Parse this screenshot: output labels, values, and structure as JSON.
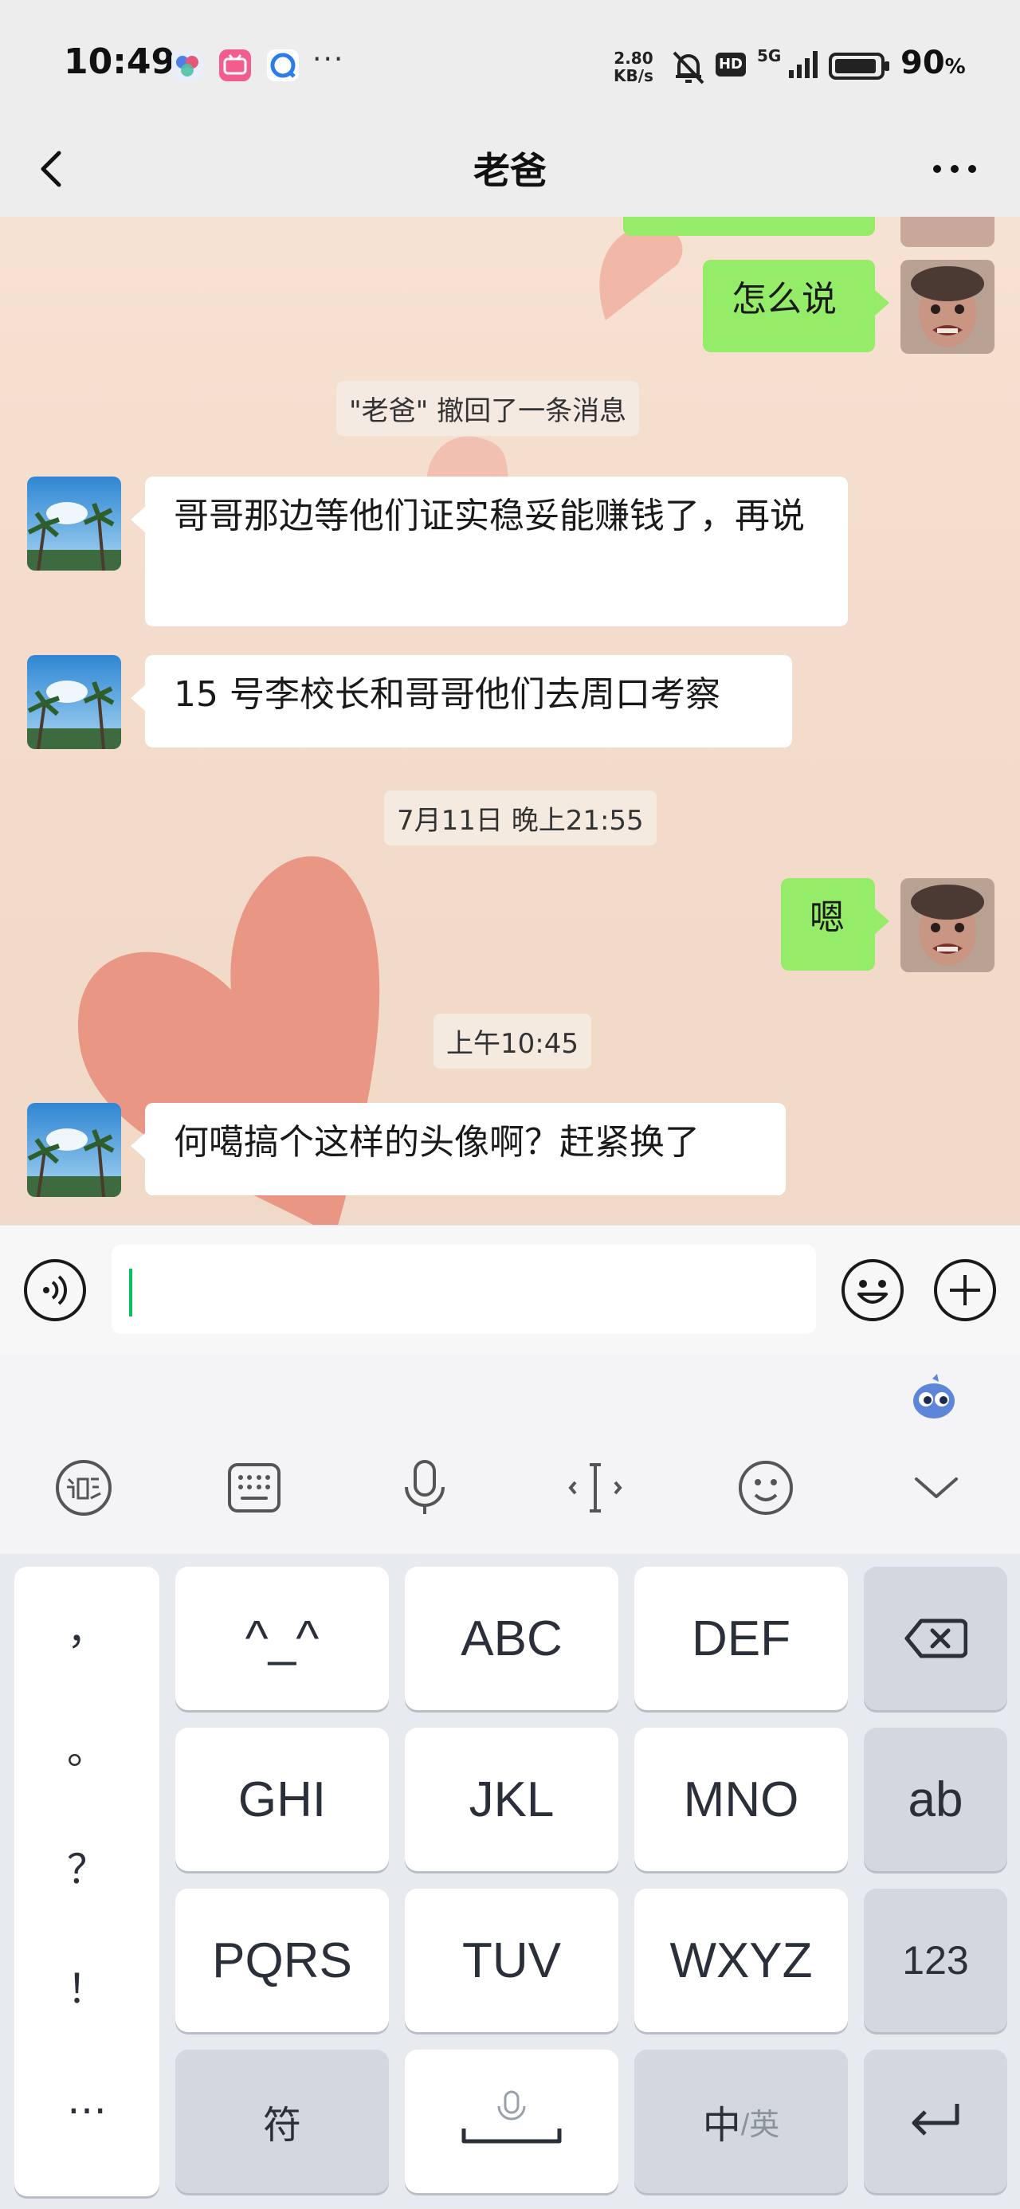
{
  "status_bar": {
    "time": "10:49",
    "more_dots": "···",
    "net_speed_value": "2.80",
    "net_speed_unit": "KB/s",
    "hd_badge": "HD",
    "network": "5G",
    "battery": "90",
    "battery_unit": "%"
  },
  "nav": {
    "back_icon": "chevron-left-icon",
    "title": "老爸",
    "more_icon": "more-horizontal-icon"
  },
  "messages": {
    "m1": "怎么说",
    "recall": "\"老爸\" 撤回了一条消息",
    "m2": "哥哥那边等他们证实稳妥能赚钱了，再说",
    "m3": "15 号李校长和哥哥他们去周口考察",
    "time1": "7月11日 晚上21:55",
    "m4": "嗯",
    "time2": "上午10:45",
    "m5": "何噶搞个这样的头像啊？赶紧换了"
  },
  "input_bar": {
    "voice_icon": "voice-icon",
    "emoji_icon": "emoji-icon",
    "plus_icon": "plus-circle-icon"
  },
  "ime_toolbar": {
    "items": [
      "ime-logo-icon",
      "keyboard-icon",
      "microphone-icon",
      "cursor-move-icon",
      "emoticon-icon",
      "collapse-icon"
    ]
  },
  "keyboard": {
    "punct": [
      "，",
      "。",
      "？",
      "！",
      "…"
    ],
    "row1": [
      "^_^",
      "ABC",
      "DEF"
    ],
    "row2": [
      "GHI",
      "JKL",
      "MNO",
      "ab"
    ],
    "row3": [
      "PQRS",
      "TUV",
      "WXYZ",
      "123"
    ],
    "row4_symbol": "符",
    "row4_lang_main": "中",
    "row4_lang_alt": "/英"
  },
  "colors": {
    "outgoing_bubble": "#95ec69",
    "incoming_bubble": "#ffffff",
    "cursor": "#07c160",
    "chat_bg": "#f3dccb",
    "heart": "#e98a78"
  }
}
